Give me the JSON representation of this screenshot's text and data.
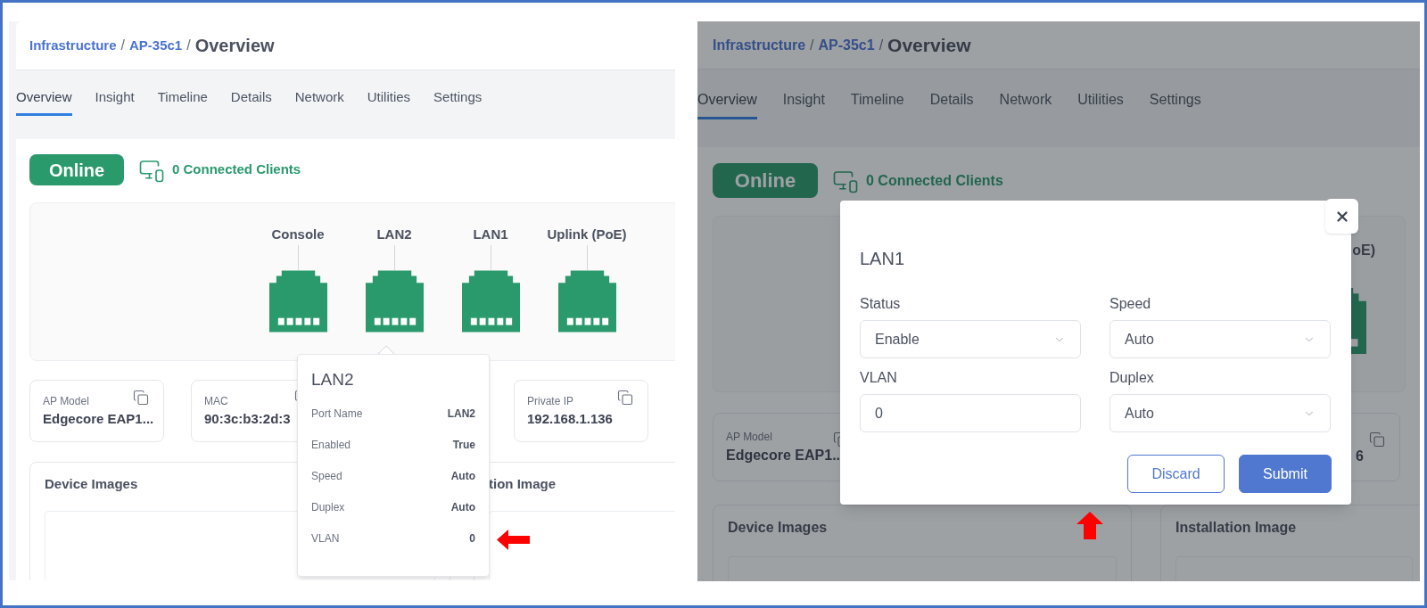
{
  "panels": [
    {
      "kind": "tooltip",
      "breadcrumb": [
        {
          "kind": "link",
          "label": "Infrastructure"
        },
        {
          "kind": "sep",
          "label": "/"
        },
        {
          "kind": "link",
          "label": "AP-35c1"
        },
        {
          "kind": "sep",
          "label": "/"
        },
        {
          "kind": "current",
          "label": "Overview"
        }
      ],
      "tabs": [
        {
          "label": "Overview",
          "selected": true
        },
        {
          "label": "Insight",
          "selected": false
        },
        {
          "label": "Timeline",
          "selected": false
        },
        {
          "label": "Details",
          "selected": false
        },
        {
          "label": "Network",
          "selected": false
        },
        {
          "label": "Utilities",
          "selected": false
        },
        {
          "label": "Settings",
          "selected": false
        }
      ],
      "status": "Online",
      "clients": "0 Connected Clients",
      "ports": [
        {
          "label": "Console"
        },
        {
          "label": "LAN2"
        },
        {
          "label": "LAN1"
        },
        {
          "label": "Uplink (PoE)"
        }
      ],
      "info_cards": [
        {
          "label": "AP Model",
          "value": "Edgecore EAP1..."
        },
        {
          "label": "MAC",
          "value": "90:3c:b3:2d:3"
        },
        {
          "label": "Private IP",
          "value": "192.168.1.136"
        }
      ],
      "sections": [
        {
          "title": "Device Images"
        },
        {
          "title": "tion Image"
        }
      ],
      "tooltip": {
        "title": "LAN2",
        "rows": [
          {
            "label": "Port Name",
            "value": "LAN2"
          },
          {
            "label": "Enabled",
            "value": "True"
          },
          {
            "label": "Speed",
            "value": "Auto"
          },
          {
            "label": "Duplex",
            "value": "Auto"
          },
          {
            "label": "VLAN",
            "value": "0"
          }
        ]
      }
    },
    {
      "kind": "modal",
      "breadcrumb": [
        {
          "kind": "link",
          "label": "Infrastructure"
        },
        {
          "kind": "sep",
          "label": "/"
        },
        {
          "kind": "link",
          "label": "AP-35c1"
        },
        {
          "kind": "sep",
          "label": "/"
        },
        {
          "kind": "current",
          "label": "Overview"
        }
      ],
      "tabs": [
        {
          "label": "Overview",
          "selected": true
        },
        {
          "label": "Insight",
          "selected": false
        },
        {
          "label": "Timeline",
          "selected": false
        },
        {
          "label": "Details",
          "selected": false
        },
        {
          "label": "Network",
          "selected": false
        },
        {
          "label": "Utilities",
          "selected": false
        },
        {
          "label": "Settings",
          "selected": false
        }
      ],
      "status": "Online",
      "clients": "0 Connected Clients",
      "ports": [
        {
          "label": "oE)"
        }
      ],
      "info_cards": [
        {
          "label": "AP Model",
          "value": "Edgecore EAP1.."
        },
        {
          "value": "6"
        }
      ],
      "sections": [
        {
          "title": "Device Images"
        },
        {
          "title": "Installation Image"
        }
      ],
      "modal": {
        "title": "LAN1",
        "fields": [
          {
            "kind": "select",
            "label": "Status",
            "value": "Enable"
          },
          {
            "kind": "select",
            "label": "Speed",
            "value": "Auto"
          },
          {
            "kind": "input",
            "label": "VLAN",
            "value": "0"
          },
          {
            "kind": "select",
            "label": "Duplex",
            "value": "Auto"
          }
        ],
        "buttons": [
          {
            "kind": "secondary",
            "label": "Discard"
          },
          {
            "kind": "primary",
            "label": "Submit"
          }
        ]
      }
    }
  ]
}
